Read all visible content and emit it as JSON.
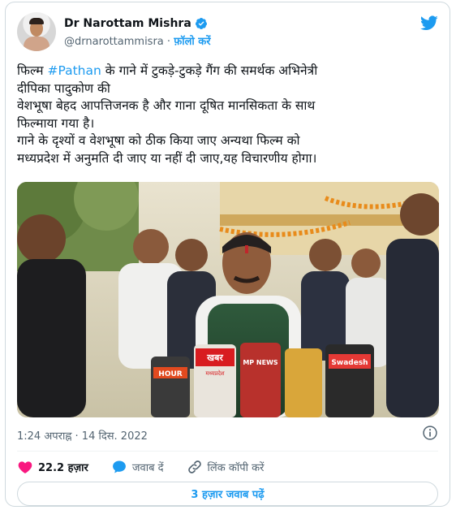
{
  "author": {
    "display_name": "Dr Narottam Mishra",
    "handle": "@drnarottammisra",
    "separator": "·",
    "follow_label": "फ़ॉलो करें"
  },
  "tweet": {
    "line1_before": "फिल्म ",
    "hashtag": "#Pathan",
    "line1_after": " के गाने में टुकड़े-टुकड़े गैंग की समर्थक अभिनेत्री",
    "rest": "दीपिका पादुकोण की\nवेशभूषा बेहद आपत्तिजनक है और गाना दूषित मानसिकता के साथ\nफिल्माया गया है।\nगाने के दृश्यों व वेशभूषा को ठीक किया जाए अन्यथा फिल्म को\nमध्यप्रदेश में अनुमति दी जाए या नहीं दी जाए,यह विचारणीय होगा।",
    "timestamp": "1:24 अपराह्न · 14 दिस. 2022"
  },
  "media": {
    "mic_labels": {
      "hour": "HOUR",
      "khabar": "खबर",
      "khabar_sub": "मध्यप्रदेश",
      "ndtv": "MP NEWS",
      "swadesh": "Swadesh"
    }
  },
  "actions": {
    "likes": "22.2 हज़ार",
    "reply_label": "जवाब दें",
    "copy_link_label": "लिंक कॉपी करें"
  },
  "replies_button": "3 हज़ार जवाब पढ़ें",
  "colors": {
    "accent": "#1d9bf0",
    "like": "#f91880",
    "text": "#0f1419",
    "secondary": "#536471"
  }
}
